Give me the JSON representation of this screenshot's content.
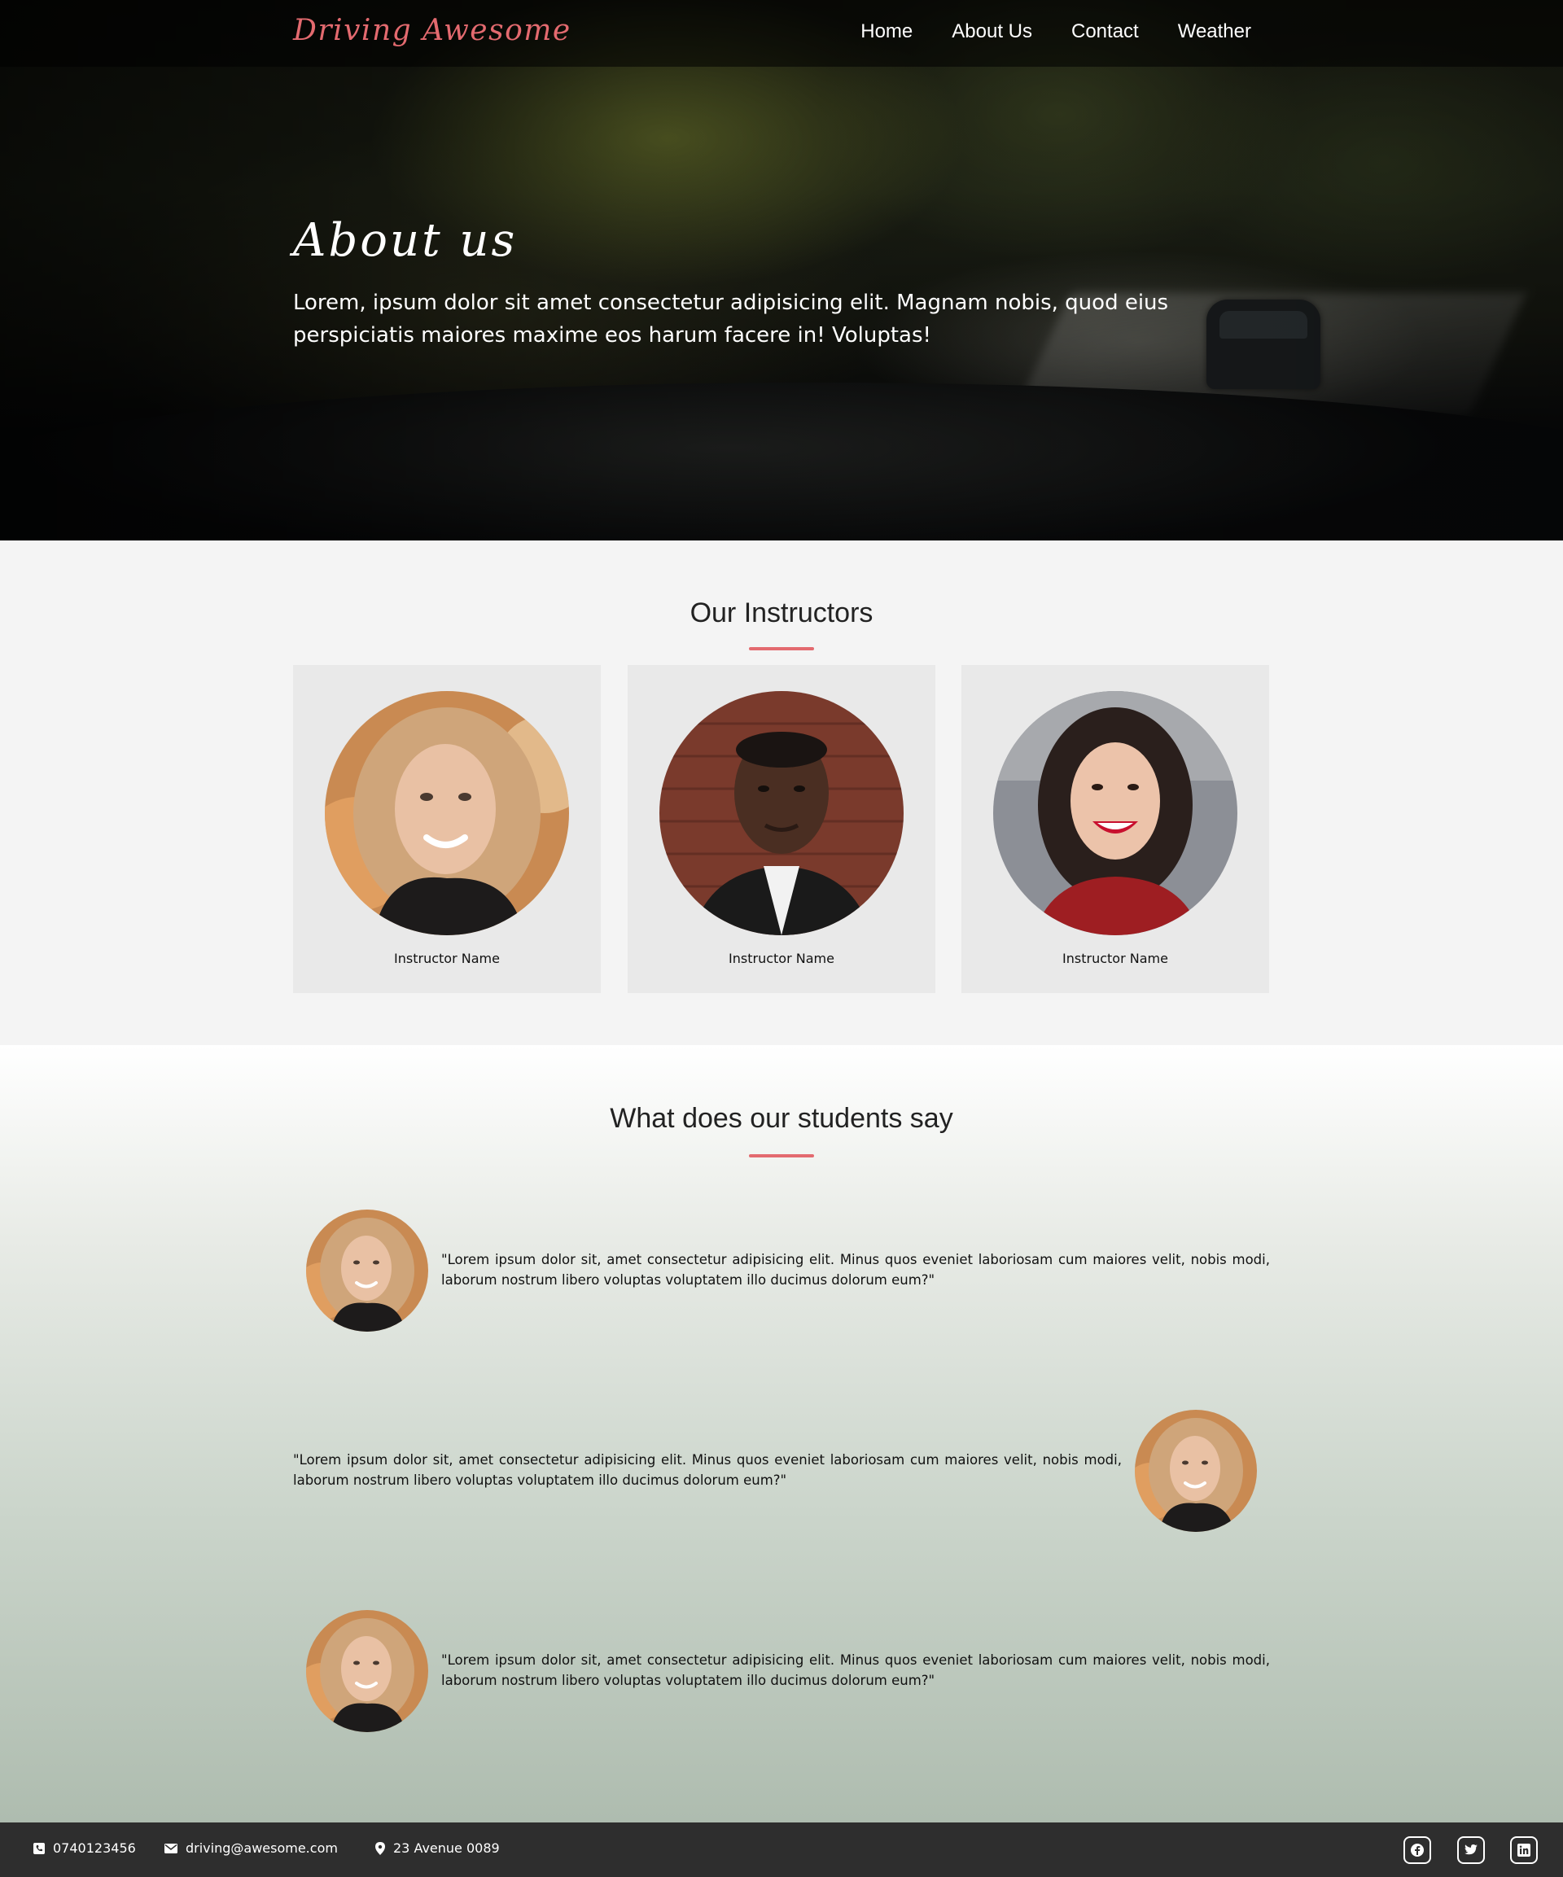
{
  "nav": {
    "brand": "Driving Awesome",
    "links": [
      "Home",
      "About Us",
      "Contact",
      "Weather"
    ]
  },
  "hero": {
    "title": "About us",
    "text": "Lorem, ipsum dolor sit amet consectetur adipisicing elit. Magnam nobis, quod eius perspiciatis maiores maxime eos harum facere in! Voluptas!"
  },
  "instructors": {
    "title": "Our Instructors",
    "cards": [
      {
        "name": "Instructor Name"
      },
      {
        "name": "Instructor Name"
      },
      {
        "name": "Instructor Name"
      }
    ]
  },
  "testimonials": {
    "title": "What does our students say",
    "items": [
      {
        "quote": "\"Lorem ipsum dolor sit, amet consectetur adipisicing elit. Minus quos eveniet laboriosam cum maiores velit, nobis modi, laborum nostrum libero voluptas voluptatem illo ducimus dolorum eum?\""
      },
      {
        "quote": "\"Lorem ipsum dolor sit, amet consectetur adipisicing elit. Minus quos eveniet laboriosam cum maiores velit, nobis modi, laborum nostrum libero voluptas voluptatem illo ducimus dolorum eum?\""
      },
      {
        "quote": "\"Lorem ipsum dolor sit, amet consectetur adipisicing elit. Minus quos eveniet laboriosam cum maiores velit, nobis modi, laborum nostrum libero voluptas voluptatem illo ducimus dolorum eum?\""
      }
    ]
  },
  "footer": {
    "phone": "0740123456",
    "email": "driving@awesome.com",
    "address": "23 Avenue 0089",
    "social": [
      "facebook-icon",
      "twitter-icon",
      "linkedin-icon"
    ]
  },
  "colors": {
    "accent": "#e36a6f",
    "footer_bg": "#2e2e2e",
    "card_bg": "#e9e9e9",
    "section_bg": "#f4f4f4"
  }
}
